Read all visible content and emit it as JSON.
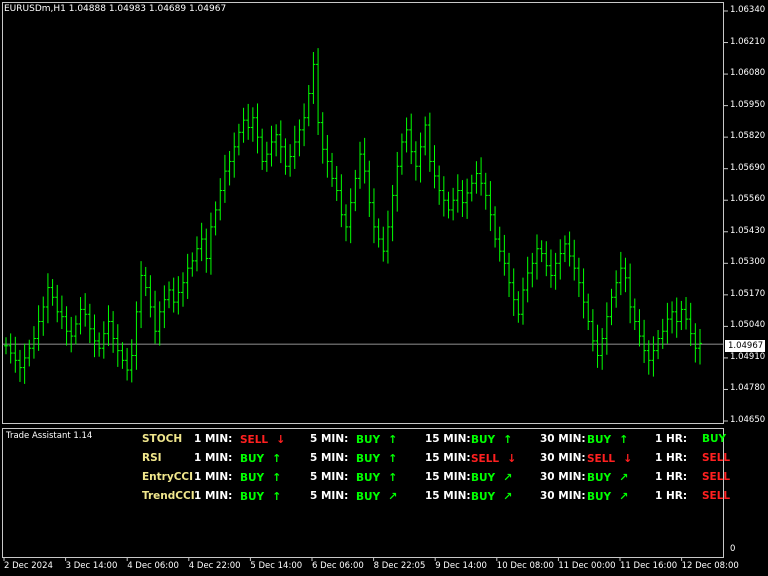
{
  "header": {
    "symbol_info": "EURUSDm,H1  1.04888 1.04983 1.04689 1.04967"
  },
  "indicator_title": "Trade Assistant 1.14",
  "current_price_label": "1.04967",
  "sub_zero_label": "0",
  "colors": {
    "up": "#00ff00",
    "down": "#ff2020",
    "label": "#f0e68c",
    "axis": "#c8c8c8",
    "bid_line": "#c0c0c0"
  },
  "dashboard": {
    "timeframes": [
      "1 MIN:",
      "5 MIN:",
      "15 MIN:",
      "30 MIN:",
      "1 HR:"
    ],
    "rows": [
      {
        "name": "STOCH",
        "signals": [
          {
            "text": "SELL",
            "dir": "down",
            "arrow": "down-icon"
          },
          {
            "text": "BUY",
            "dir": "up",
            "arrow": "up-icon"
          },
          {
            "text": "BUY",
            "dir": "up",
            "arrow": "up-icon"
          },
          {
            "text": "BUY",
            "dir": "up",
            "arrow": "up-icon"
          },
          {
            "text": "BUY",
            "dir": "up",
            "arrow": ""
          }
        ]
      },
      {
        "name": "RSI",
        "signals": [
          {
            "text": "BUY",
            "dir": "up",
            "arrow": "up-icon"
          },
          {
            "text": "BUY",
            "dir": "up",
            "arrow": "up-icon"
          },
          {
            "text": "SELL",
            "dir": "down",
            "arrow": "down-icon"
          },
          {
            "text": "SELL",
            "dir": "down",
            "arrow": "down-icon"
          },
          {
            "text": "SELL",
            "dir": "down",
            "arrow": ""
          }
        ]
      },
      {
        "name": "EntryCCI",
        "signals": [
          {
            "text": "BUY",
            "dir": "up",
            "arrow": "up-icon"
          },
          {
            "text": "BUY",
            "dir": "up",
            "arrow": "up-icon"
          },
          {
            "text": "BUY",
            "dir": "up",
            "arrow": "up-right-icon"
          },
          {
            "text": "BUY",
            "dir": "up",
            "arrow": "up-right-icon"
          },
          {
            "text": "SELL",
            "dir": "down",
            "arrow": ""
          }
        ]
      },
      {
        "name": "TrendCCI",
        "signals": [
          {
            "text": "BUY",
            "dir": "up",
            "arrow": "up-icon"
          },
          {
            "text": "BUY",
            "dir": "up",
            "arrow": "up-right-icon"
          },
          {
            "text": "BUY",
            "dir": "up",
            "arrow": "up-right-icon"
          },
          {
            "text": "BUY",
            "dir": "up",
            "arrow": "up-right-icon"
          },
          {
            "text": "SELL",
            "dir": "down",
            "arrow": ""
          }
        ]
      }
    ]
  },
  "chart_data": {
    "type": "bar",
    "title": "EURUSDm,H1  1.04888 1.04983 1.04689 1.04967",
    "y_ticks": [
      "1.06340",
      "1.06210",
      "1.06080",
      "1.05950",
      "1.05820",
      "1.05690",
      "1.05560",
      "1.05430",
      "1.05300",
      "1.05170",
      "1.05040",
      "1.04910",
      "1.04780",
      "1.04650"
    ],
    "ylim": [
      1.0465,
      1.0634
    ],
    "x_ticks": [
      "2 Dec 2024",
      "3 Dec 14:00",
      "4 Dec 06:00",
      "4 Dec 22:00",
      "5 Dec 14:00",
      "6 Dec 06:00",
      "8 Dec 22:05",
      "9 Dec 14:00",
      "10 Dec 08:00",
      "11 Dec 00:00",
      "11 Dec 16:00",
      "12 Dec 08:00"
    ],
    "current_price": 1.04967,
    "series": [
      {
        "close": [
          1.0496,
          1.0493,
          1.049,
          1.0487,
          1.0491,
          1.0495,
          1.0499,
          1.0506,
          1.0512,
          1.052,
          1.0516,
          1.051,
          1.0508,
          1.0502,
          1.05,
          1.0505,
          1.0511,
          1.0509,
          1.0503,
          1.0498,
          1.0495,
          1.0501,
          1.0506,
          1.0499,
          1.0494,
          1.049,
          1.0486,
          1.0492,
          1.051,
          1.0525,
          1.052,
          1.0512,
          1.0502,
          1.051,
          1.0515,
          1.0519,
          1.0514,
          1.0518,
          1.0522,
          1.0528,
          1.0531,
          1.0536,
          1.054,
          1.0532,
          1.0545,
          1.0552,
          1.056,
          1.0568,
          1.0572,
          1.0578,
          1.0584,
          1.0589,
          1.0586,
          1.059,
          1.0582,
          1.0572,
          1.0575,
          1.058,
          1.0583,
          1.0578,
          1.057,
          1.0574,
          1.058,
          1.0585,
          1.059,
          1.06,
          1.0612,
          1.0588,
          1.0577,
          1.0572,
          1.0565,
          1.056,
          1.055,
          1.0545,
          1.0555,
          1.0565,
          1.0575,
          1.0568,
          1.0555,
          1.0545,
          1.054,
          1.0535,
          1.0545,
          1.0558,
          1.057,
          1.058,
          1.0585,
          1.0576,
          1.057,
          1.0578,
          1.0587,
          1.0572,
          1.0566,
          1.056,
          1.0556,
          1.0552,
          1.0556,
          1.056,
          1.0555,
          1.0559,
          1.0563,
          1.0567,
          1.0563,
          1.0558,
          1.055,
          1.054,
          1.0535,
          1.053,
          1.0522,
          1.0515,
          1.0509,
          1.0519,
          1.0526,
          1.053,
          1.0536,
          1.0534,
          1.0529,
          1.0525,
          1.053,
          1.0534,
          1.0538,
          1.0533,
          1.0528,
          1.0522,
          1.0514,
          1.0506,
          1.0498,
          1.0492,
          1.0499,
          1.0508,
          1.0516,
          1.0522,
          1.0528,
          1.0524,
          1.0512,
          1.0506,
          1.05,
          1.0494,
          1.049,
          1.0494,
          1.0499,
          1.0502,
          1.0507,
          1.051,
          1.0506,
          1.0511,
          1.0507,
          1.0501,
          1.0495,
          1.0497
        ]
      }
    ]
  }
}
